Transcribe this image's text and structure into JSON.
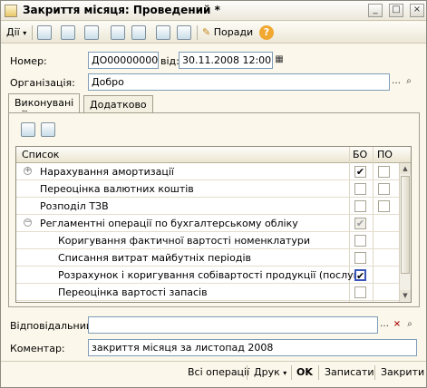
{
  "window": {
    "title": "Закриття місяця: Проведений *",
    "buttons": {
      "minimize": "_",
      "maximize": "□",
      "close": "×"
    }
  },
  "toolbar": {
    "actions_label": "Дії",
    "tips_label": "Поради"
  },
  "form": {
    "number_label": "Номер:",
    "number_value": "ДО000000006",
    "date_label": "від:",
    "date_value": "30.11.2008 12:00:00",
    "organization_label": "Організація:",
    "organization_value": "Добро",
    "responsible_label": "Відповідальний:",
    "responsible_value": "",
    "comment_label": "Коментар:",
    "comment_value": "закриття місяця за листопад 2008"
  },
  "tabs": [
    {
      "label": "Виконувані дії",
      "active": true
    },
    {
      "label": "Додатково",
      "active": false
    }
  ],
  "grid": {
    "columns": {
      "name": "Список",
      "bo": "БО",
      "po": "ПО"
    },
    "rows": [
      {
        "name": "Нарахування амортизації",
        "level": 0,
        "expander": "+",
        "bo": "✔",
        "po": ""
      },
      {
        "name": "Переоцінка валютних коштів",
        "level": 0,
        "expander": "",
        "bo": "",
        "po": ""
      },
      {
        "name": "Розподіл ТЗВ",
        "level": 0,
        "expander": "",
        "bo": "",
        "po": ""
      },
      {
        "name": "Регламентні операції по бухгалтерському обліку",
        "level": 0,
        "expander": "−",
        "bo": "✔",
        "po": ""
      },
      {
        "name": "Коригування фактичної вартості номенклатури",
        "level": 1,
        "expander": "",
        "bo": "",
        "po": ""
      },
      {
        "name": "Списання витрат майбутніх періодів",
        "level": 1,
        "expander": "",
        "bo": "",
        "po": ""
      },
      {
        "name": "Розрахунок і коригування собівартості продукції (послуг)",
        "level": 1,
        "expander": "",
        "bo": "✔",
        "po": ""
      },
      {
        "name": "Переоцінка вартості запасів",
        "level": 1,
        "expander": "",
        "bo": "",
        "po": ""
      }
    ]
  },
  "footer": {
    "all_ops": "Всі операції",
    "print": "Друк",
    "ok": "OK",
    "save": "Записати",
    "close": "Закрити"
  }
}
